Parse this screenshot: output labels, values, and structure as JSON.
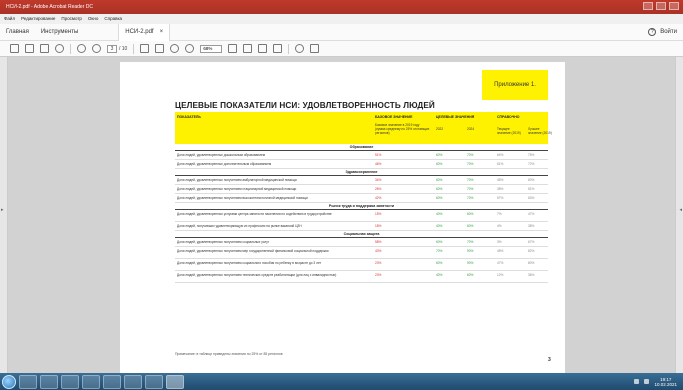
{
  "window": {
    "title": "НСИ-2.pdf - Adobe Acrobat Reader DC"
  },
  "menubar": [
    "Файл",
    "Редактирование",
    "Просмотр",
    "Окно",
    "Справка"
  ],
  "tabs": {
    "home": "Главная",
    "tools": "Инструменты",
    "document": "НСИ-2.pdf",
    "close": "×",
    "help": "?",
    "signin": "Войти"
  },
  "toolbar": {
    "page_current": "3",
    "page_total": "/ 10",
    "zoom": "68%"
  },
  "document": {
    "appendix": "Приложение 1.",
    "title": "ЦЕЛЕВЫЕ ПОКАЗАТЕЛИ НСИ: УДОВЛЕТВОРЕННОСТЬ ЛЮДЕЙ",
    "headers": {
      "indicator": "ПОКАЗАТЕЛЬ",
      "base": "БАЗОВОЕ ЗНАЧЕНИЕ",
      "base_sub": "Базовое значение в 2019 году (сумма среднему по 25% отстающих регионов)",
      "target": "ЦЕЛЕВЫЕ ЗНАЧЕНИЯ",
      "y2022": "2022",
      "y2024": "2024",
      "reference": "СПРАВОЧНО",
      "current": "Текущее значение (2019)",
      "best": "Лучшее значение (2019)"
    },
    "sections": [
      {
        "title": "Образование",
        "rows": [
          {
            "name": "Доля людей, удовлетворенных дошкольным образованием",
            "base": "51%",
            "t22": "60%",
            "t24": "70%",
            "cur": "64%",
            "best": "75%"
          },
          {
            "name": "Доля людей, удовлетворенных дополнительным образованием",
            "base": "46%",
            "t22": "60%",
            "t24": "70%",
            "cur": "61%",
            "best": "72%"
          }
        ]
      },
      {
        "title": "Здравоохранение",
        "rows": [
          {
            "name": "Доля людей, удовлетворенных получением амбулаторной медицинской помощи",
            "base": "34%",
            "t22": "60%",
            "t24": "70%",
            "cur": "45%",
            "best": "60%"
          },
          {
            "name": "Доля людей, удовлетворенных получением стационарной медицинской помощи",
            "base": "26%",
            "t22": "60%",
            "t24": "70%",
            "cur": "38%",
            "best": "51%"
          },
          {
            "name": "Доля людей, удовлетворенных получением высокотехнологичной медицинской помощи",
            "base": "42%",
            "t22": "60%",
            "t24": "70%",
            "cur": "57%",
            "best": "63%"
          }
        ]
      },
      {
        "title": "Рынок труда и поддержка занятости",
        "rows": [
          {
            "name": "Доля людей, удовлетворенных услугами центра занятости населения по содействию в трудоустройстве",
            "base": "15%",
            "t22": "40%",
            "t24": "60%",
            "cur": "7%",
            "best": "47%",
            "tall": true
          },
          {
            "name": "Доля людей, получивших удовлетворяющую их профессию на рынке вакансий ЦЗН",
            "base": "18%",
            "t22": "40%",
            "t24": "60%",
            "cur": "4%",
            "best": "38%"
          }
        ]
      },
      {
        "title": "Социальная защита",
        "rows": [
          {
            "name": "Доля людей, удовлетворенных получением социальных услуг",
            "base": "58%",
            "t22": "60%",
            "t24": "70%",
            "cur": "3%",
            "best": "67%"
          },
          {
            "name": "Доля людей, удовлетворенных получением мер государственной финансовой социальной поддержки",
            "base": "43%",
            "t22": "70%",
            "t24": "90%",
            "cur": "45%",
            "best": "82%",
            "tall": true
          },
          {
            "name": "Доля людей, удовлетворенных получением социального пособия по ребенку в возрасте до 3 лет",
            "base": "23%",
            "t22": "60%",
            "t24": "90%",
            "cur": "47%",
            "best": "80%",
            "tall": true
          },
          {
            "name": "Доля людей, удовлетворенных получением технических средств реабилитации (для лиц с инвалидностью)",
            "base": "23%",
            "t22": "40%",
            "t24": "60%",
            "cur": "12%",
            "best": "36%",
            "tall": true
          }
        ]
      }
    ],
    "footnote": "Примечание: в таблице приведены значения по 25% от 85 регионов",
    "page_number": "3"
  },
  "taskbar": {
    "clock_time": "19:17",
    "clock_date": "10.02.2021"
  }
}
